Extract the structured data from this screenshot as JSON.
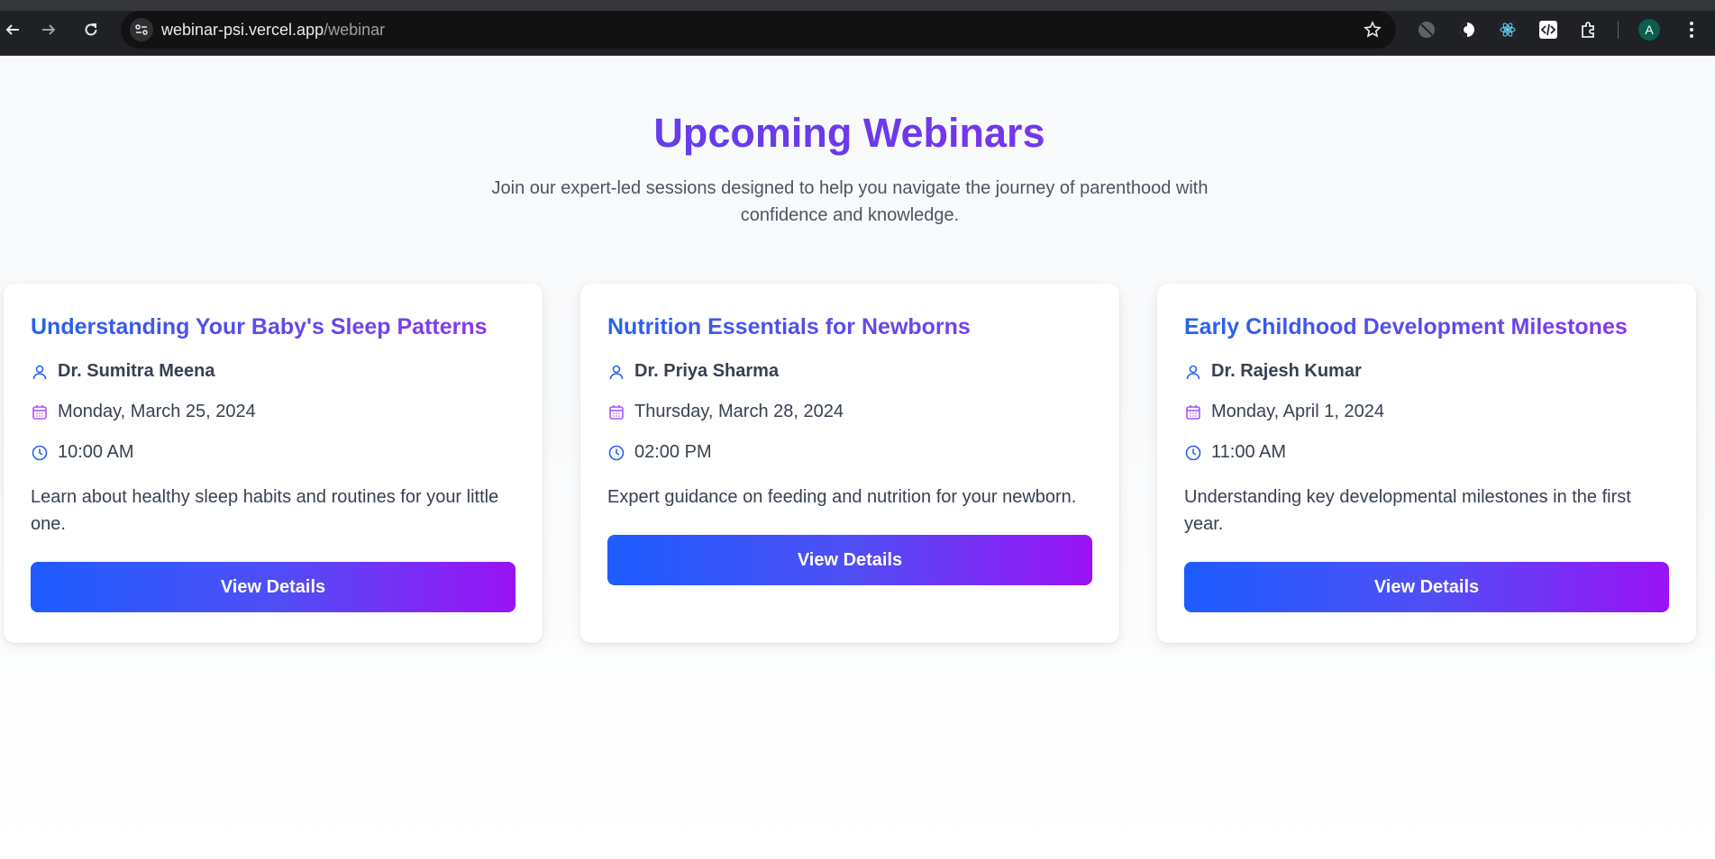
{
  "browser": {
    "url_host": "webinar-psi.vercel.app",
    "url_path": "/webinar",
    "profile_initial": "A"
  },
  "page": {
    "title": "Upcoming Webinars",
    "subtitle": "Join our expert-led sessions designed to help you navigate the journey of parenthood with confidence and knowledge."
  },
  "webinars": [
    {
      "title": "Understanding Your Baby's Sleep Patterns",
      "speaker": "Dr. Sumitra Meena",
      "date": "Monday, March 25, 2024",
      "time": "10:00 AM",
      "description": "Learn about healthy sleep habits and routines for your little one.",
      "button_label": "View Details"
    },
    {
      "title": "Nutrition Essentials for Newborns",
      "speaker": "Dr. Priya Sharma",
      "date": "Thursday, March 28, 2024",
      "time": "02:00 PM",
      "description": "Expert guidance on feeding and nutrition for your newborn.",
      "button_label": "View Details"
    },
    {
      "title": "Early Childhood Development Milestones",
      "speaker": "Dr. Rajesh Kumar",
      "date": "Monday, April 1, 2024",
      "time": "11:00 AM",
      "description": "Understanding key developmental milestones in the first year.",
      "button_label": "View Details"
    }
  ],
  "colors": {
    "title_gradient_start": "#4f46e5",
    "title_gradient_end": "#8b2cf5",
    "button_gradient_start": "#1d5cff",
    "button_gradient_end": "#9a12f5",
    "user_icon": "#2563eb",
    "calendar_icon": "#a855f7",
    "clock_icon": "#2563eb"
  },
  "icons": {
    "speaker": "user-icon",
    "date": "calendar-icon",
    "time": "clock-icon"
  }
}
